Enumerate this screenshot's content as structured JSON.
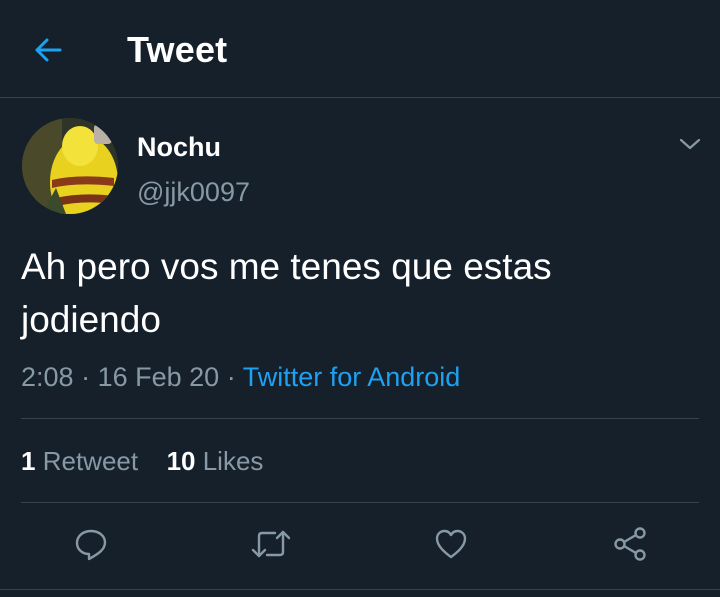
{
  "header": {
    "title": "Tweet",
    "back_icon": "arrow-left-icon"
  },
  "author": {
    "display_name": "Nochu",
    "handle": "@jjk0097"
  },
  "tweet": {
    "text": "Ah pero vos me tenes que estas jodiendo",
    "time": "2:08",
    "date": "16 Feb 20",
    "separator": "·",
    "source": "Twitter for Android"
  },
  "stats": {
    "retweets_count": "1",
    "retweets_label": "Retweet",
    "likes_count": "10",
    "likes_label": "Likes"
  },
  "actions": {
    "icons": [
      "reply-icon",
      "retweet-icon",
      "like-icon",
      "share-icon"
    ]
  },
  "colors": {
    "background": "#15202b",
    "accent": "#1da1f2",
    "secondary_text": "#8899a6",
    "divider": "#38444d"
  }
}
